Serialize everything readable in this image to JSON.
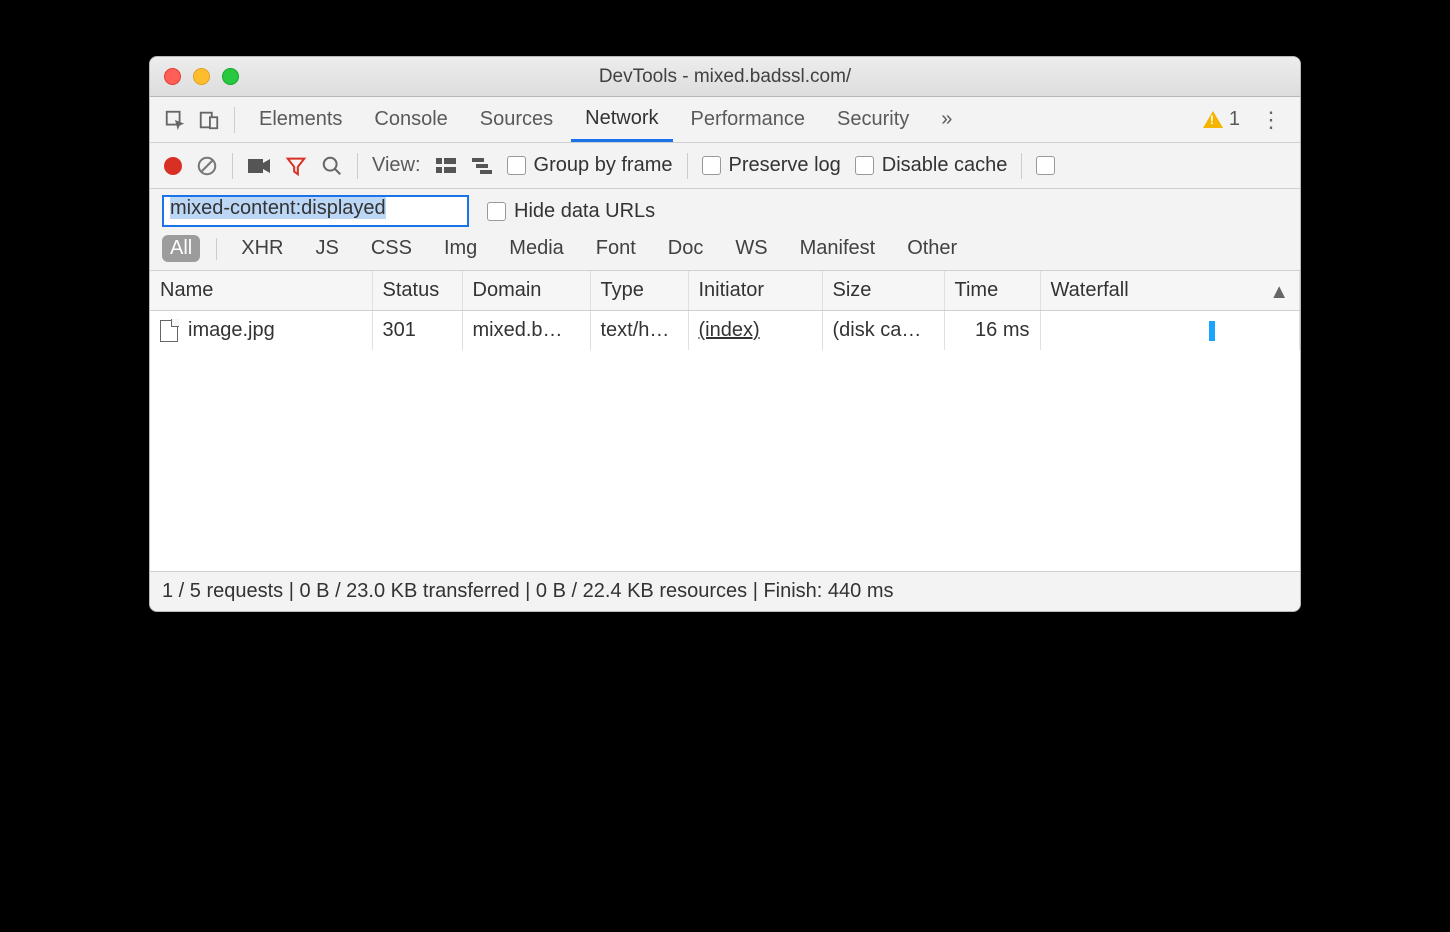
{
  "window": {
    "title": "DevTools - mixed.badssl.com/"
  },
  "tabs": {
    "items": [
      "Elements",
      "Console",
      "Sources",
      "Network",
      "Performance",
      "Security"
    ],
    "active": "Network",
    "overflow": "»",
    "warning_count": "1"
  },
  "toolbar": {
    "view_label": "View:",
    "group_by_frame": "Group by frame",
    "preserve_log": "Preserve log",
    "disable_cache": "Disable cache"
  },
  "filter": {
    "value": "mixed-content:displayed",
    "hide_data_urls": "Hide data URLs"
  },
  "type_filters": [
    "All",
    "XHR",
    "JS",
    "CSS",
    "Img",
    "Media",
    "Font",
    "Doc",
    "WS",
    "Manifest",
    "Other"
  ],
  "type_filter_active": "All",
  "columns": [
    "Name",
    "Status",
    "Domain",
    "Type",
    "Initiator",
    "Size",
    "Time",
    "Waterfall"
  ],
  "rows": [
    {
      "name": "image.jpg",
      "status": "301",
      "domain": "mixed.b…",
      "type": "text/h…",
      "initiator": "(index)",
      "size": "(disk ca…",
      "time": "16 ms"
    }
  ],
  "status_bar": "1 / 5 requests | 0 B / 23.0 KB transferred | 0 B / 22.4 KB resources | Finish: 440 ms"
}
